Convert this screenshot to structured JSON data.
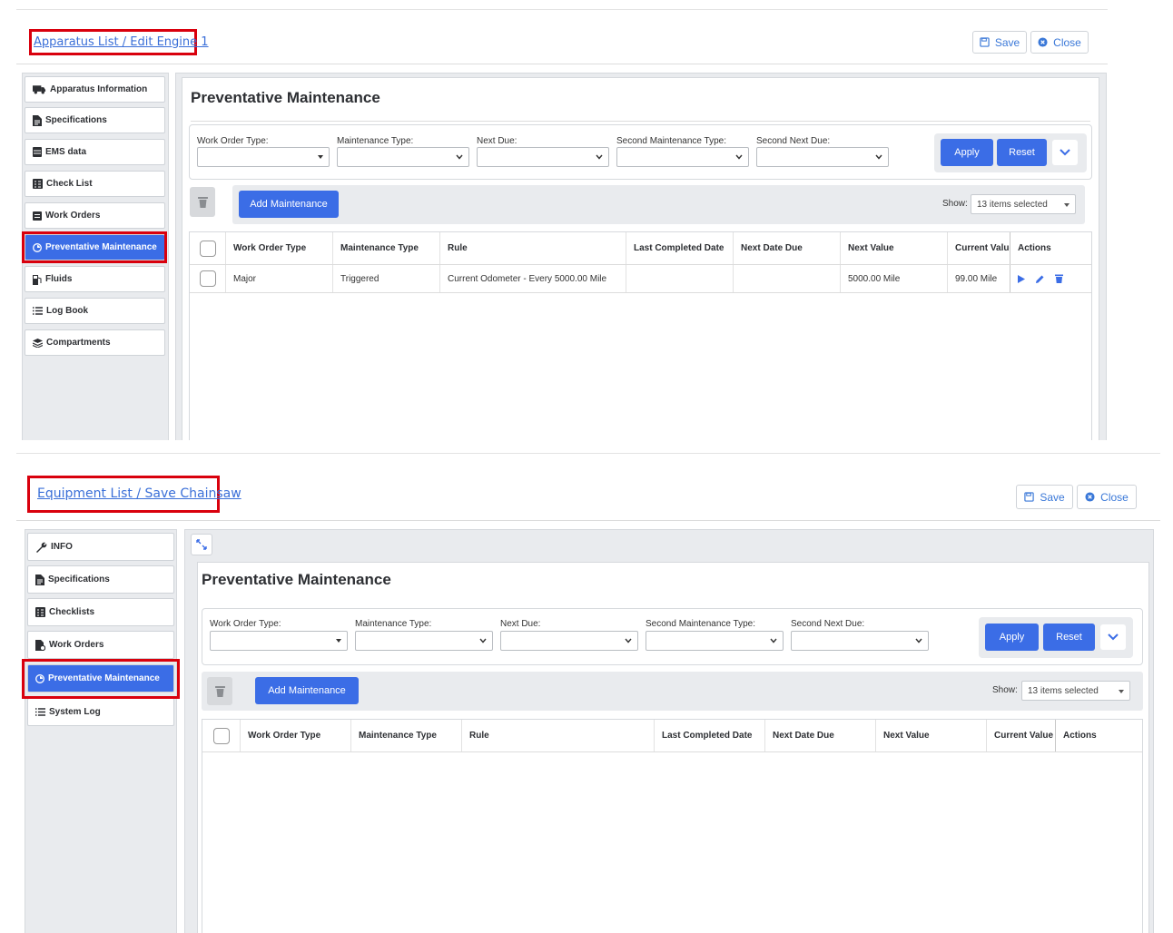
{
  "panel1": {
    "breadcrumb": "Apparatus List / Edit Engine 1",
    "save_label": "Save",
    "close_label": "Close",
    "sidebar": [
      {
        "label": "Apparatus Information",
        "icon": "truck-icon"
      },
      {
        "label": "Specifications",
        "icon": "document-icon"
      },
      {
        "label": "EMS data",
        "icon": "database-icon"
      },
      {
        "label": "Check List",
        "icon": "checklist-icon"
      },
      {
        "label": "Work Orders",
        "icon": "list-box-icon"
      },
      {
        "label": "Preventative Maintenance",
        "icon": "clock-icon",
        "active": true
      },
      {
        "label": "Fluids",
        "icon": "fuel-icon"
      },
      {
        "label": "Log Book",
        "icon": "list-icon"
      },
      {
        "label": "Compartments",
        "icon": "layers-icon"
      }
    ],
    "title": "Preventative Maintenance",
    "filters": {
      "work_order_type": "Work Order Type:",
      "maintenance_type": "Maintenance Type:",
      "next_due": "Next Due:",
      "second_maintenance_type": "Second Maintenance Type:",
      "second_next_due": "Second Next Due:",
      "apply": "Apply",
      "reset": "Reset"
    },
    "add_maintenance": "Add Maintenance",
    "show_label": "Show:",
    "show_value": "13 items selected",
    "columns": [
      "Work Order Type",
      "Maintenance Type",
      "Rule",
      "Last Completed Date",
      "Next Date Due",
      "Next Value",
      "Current Value",
      "Actions"
    ],
    "rows": [
      {
        "work_order_type": "Major",
        "maintenance_type": "Triggered",
        "rule": "Current Odometer - Every 5000.00 Mile",
        "last_completed": "",
        "next_date_due": "",
        "next_value": "5000.00 Mile",
        "current_value": "99.00 Mile"
      }
    ]
  },
  "panel2": {
    "breadcrumb": "Equipment List / Save Chainsaw",
    "save_label": "Save",
    "close_label": "Close",
    "sidebar": [
      {
        "label": "INFO",
        "icon": "wrench-icon"
      },
      {
        "label": "Specifications",
        "icon": "document-icon"
      },
      {
        "label": "Checklists",
        "icon": "checklist-icon"
      },
      {
        "label": "Work Orders",
        "icon": "work-order-icon"
      },
      {
        "label": "Preventative Maintenance",
        "icon": "clock-icon",
        "active": true
      },
      {
        "label": "System Log",
        "icon": "list-icon"
      }
    ],
    "title": "Preventative Maintenance",
    "filters": {
      "work_order_type": "Work Order Type:",
      "maintenance_type": "Maintenance Type:",
      "next_due": "Next Due:",
      "second_maintenance_type": "Second Maintenance Type:",
      "second_next_due": "Second Next Due:",
      "apply": "Apply",
      "reset": "Reset"
    },
    "add_maintenance": "Add Maintenance",
    "show_label": "Show:",
    "show_value": "13 items selected",
    "columns": [
      "Work Order Type",
      "Maintenance Type",
      "Rule",
      "Last Completed Date",
      "Next Date Due",
      "Next Value",
      "Current Value",
      "Actions"
    ]
  },
  "colors": {
    "accent": "#3b6de6",
    "highlight": "#d9000d",
    "link": "#3a6fd8"
  }
}
